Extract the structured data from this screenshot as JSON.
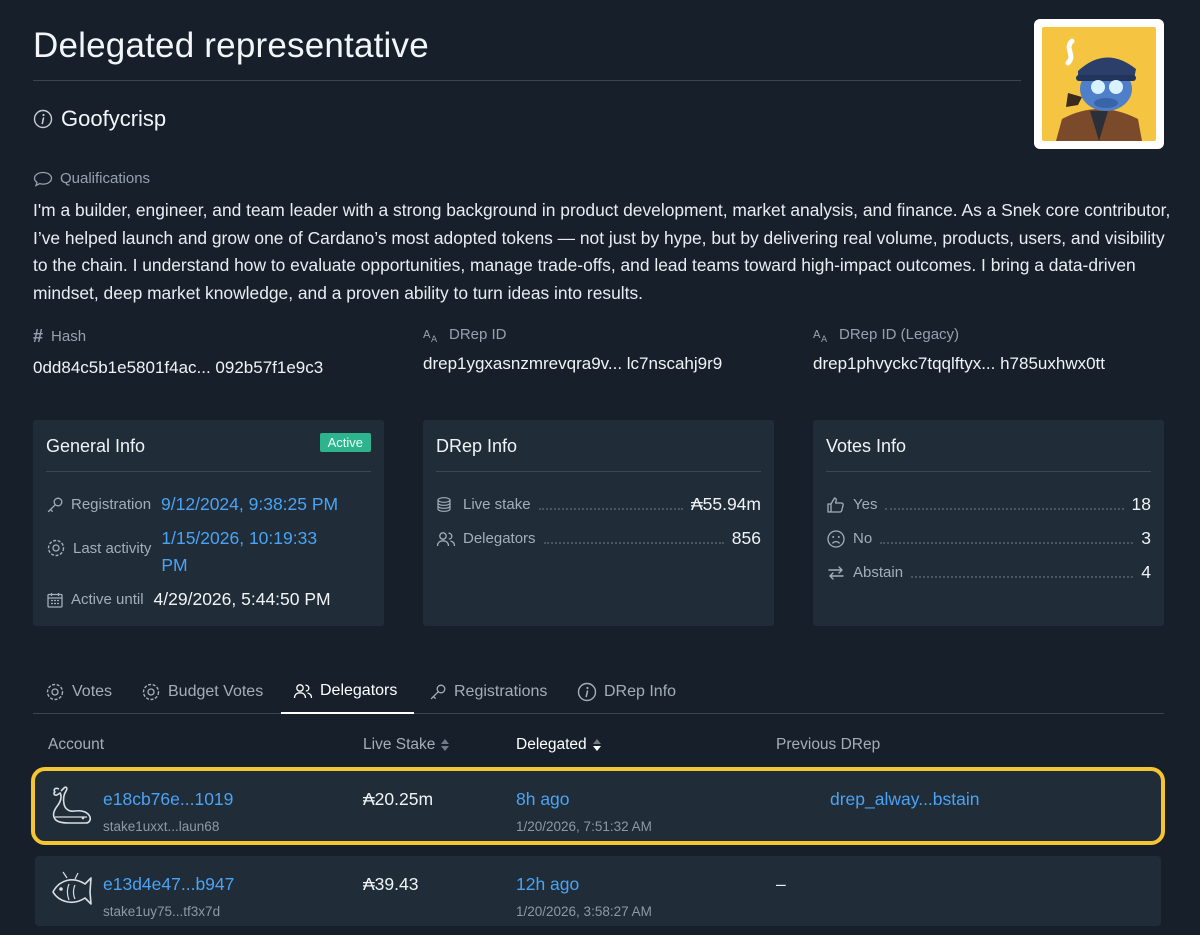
{
  "page": {
    "title": "Delegated representative"
  },
  "drep": {
    "name": "Goofycrisp",
    "qualifications_label": "Qualifications",
    "qualifications_text": "I'm a builder, engineer, and team leader with a strong background in product development, market analysis, and finance. As a Snek core contributor, I’ve helped launch and grow one of Cardano’s most adopted tokens — not just by hype, but by delivering real volume, products, users, and visibility to the chain. I understand how to evaluate opportunities, manage trade-offs, and lead teams toward high-impact outcomes. I bring a data-driven mindset, deep market knowledge, and a proven ability to turn ideas into results."
  },
  "ids": {
    "hash": {
      "label": "Hash",
      "value": "0dd84c5b1e5801f4ac... 092b57f1e9c3"
    },
    "drep_id": {
      "label": "DRep ID",
      "value": "drep1ygxasnzmrevqra9v... lc7nscahj9r9"
    },
    "drep_id_legacy": {
      "label": "DRep ID (Legacy)",
      "value": "drep1phvyckc7tqqlftyx... h785uxhwx0tt"
    }
  },
  "general_info": {
    "title": "General Info",
    "status": "Active",
    "registration_label": "Registration",
    "registration_value": "9/12/2024, 9:38:25 PM",
    "last_activity_label": "Last activity",
    "last_activity_value_line1": "1/15/2026, 10:19:33",
    "last_activity_value_line2": "PM",
    "active_until_label": "Active until",
    "active_until_value": "4/29/2026, 5:44:50 PM"
  },
  "drep_info": {
    "title": "DRep Info",
    "live_stake_label": "Live stake",
    "live_stake_value": "₳55.94m",
    "delegators_label": "Delegators",
    "delegators_value": "856"
  },
  "votes_info": {
    "title": "Votes Info",
    "yes_label": "Yes",
    "yes_value": "18",
    "no_label": "No",
    "no_value": "3",
    "abstain_label": "Abstain",
    "abstain_value": "4"
  },
  "tabs": [
    {
      "label": "Votes",
      "icon": "gear-icon"
    },
    {
      "label": "Budget Votes",
      "icon": "gear-icon"
    },
    {
      "label": "Delegators",
      "icon": "users-icon",
      "active": true
    },
    {
      "label": "Registrations",
      "icon": "key-icon"
    },
    {
      "label": "DRep Info",
      "icon": "info-icon"
    }
  ],
  "table": {
    "headers": {
      "account": "Account",
      "live_stake": "Live Stake",
      "delegated": "Delegated",
      "previous_drep": "Previous DRep"
    },
    "rows": [
      {
        "icon": "whale-icon",
        "account": "e18cb76e...1019",
        "stake_address": "stake1uxxt...laun68",
        "live_stake": "₳20.25m",
        "delegated_ago": "8h ago",
        "delegated_date": "1/20/2026, 7:51:32 AM",
        "previous_drep": "drep_alway...bstain"
      },
      {
        "icon": "fish-icon",
        "account": "e13d4e47...b947",
        "stake_address": "stake1uy75...tf3x7d",
        "live_stake": "₳39.43",
        "delegated_ago": "12h ago",
        "delegated_date": "1/20/2026, 3:58:27 AM",
        "previous_drep": "–"
      }
    ]
  },
  "colors": {
    "background": "#17202a",
    "card": "#202c37",
    "link": "#4aa3f5",
    "active_badge": "#2eb38f",
    "highlight": "#f5c532"
  }
}
